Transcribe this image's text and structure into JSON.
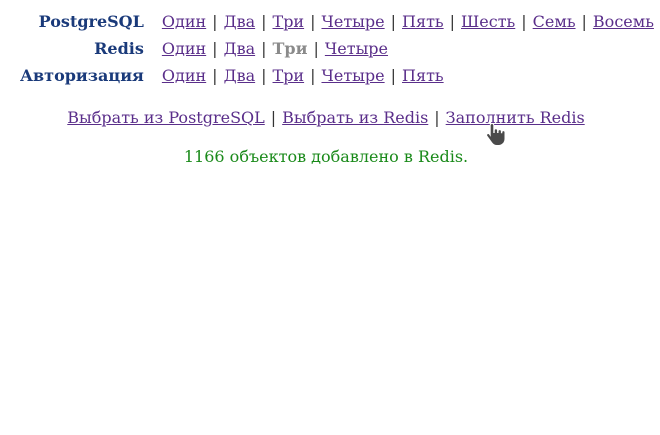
{
  "nav": {
    "rows": [
      {
        "label": "PostgreSQL",
        "links": [
          "Один",
          "Два",
          "Три",
          "Четыре",
          "Пять",
          "Шесть",
          "Семь",
          "Восемь"
        ],
        "current": null
      },
      {
        "label": "Redis",
        "links": [
          "Один",
          "Два",
          "Три",
          "Четыре"
        ],
        "current": 2
      },
      {
        "label": "Авторизация",
        "links": [
          "Один",
          "Два",
          "Три",
          "Четыре",
          "Пять"
        ],
        "current": null
      }
    ]
  },
  "actions": {
    "select_postgres": "Выбрать из PostgreSQL",
    "select_redis": "Выбрать из Redis",
    "fill_redis": "Заполнить Redis",
    "separator": "|"
  },
  "status": {
    "message": "1166 объектов добавлено в Redis.",
    "color": "#1a8a1a"
  },
  "colors": {
    "label": "#1a3a7a",
    "link": "#5a2e8a",
    "current": "#8a8a8a"
  },
  "cursor_icon": "hand-pointer-icon"
}
